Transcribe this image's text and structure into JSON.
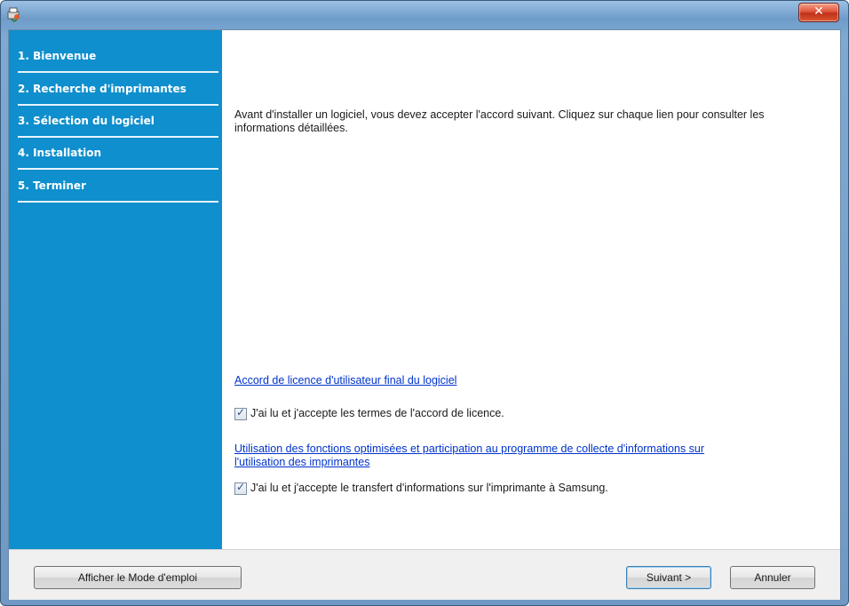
{
  "window": {
    "title": ""
  },
  "icons": {
    "app": "installer-app-icon",
    "close": "close-icon",
    "check": "checkmark-icon"
  },
  "sidebar": {
    "steps": [
      {
        "label": "1. Bienvenue",
        "active": true
      },
      {
        "label": "2. Recherche d'imprimantes",
        "active": false
      },
      {
        "label": "3. Sélection du logiciel",
        "active": false
      },
      {
        "label": "4. Installation",
        "active": false
      },
      {
        "label": "5. Terminer",
        "active": false
      }
    ]
  },
  "content": {
    "intro": "Avant d'installer un logiciel, vous devez accepter l'accord suivant. Cliquez sur chaque lien pour consulter les informations détaillées.",
    "license_link": "Accord de licence d'utilisateur final du logiciel",
    "license_checkbox": {
      "label": "J'ai lu et j'accepte les termes de l'accord de licence.",
      "checked": true
    },
    "data_link_line1": "Utilisation des fonctions optimisées et participation au programme de collecte d'informations sur",
    "data_link_line2": "l'utilisation des imprimantes",
    "data_checkbox": {
      "label": "J'ai lu et j'accepte le transfert d'informations sur l'imprimante à Samsung.",
      "checked": true
    }
  },
  "footer": {
    "manual_button": "Afficher le Mode d'emploi",
    "next_button": "Suivant >",
    "cancel_button": "Annuler"
  },
  "colors": {
    "sidebar": "#0f8fcd",
    "link": "#0033cc",
    "close": "#c1301b"
  }
}
